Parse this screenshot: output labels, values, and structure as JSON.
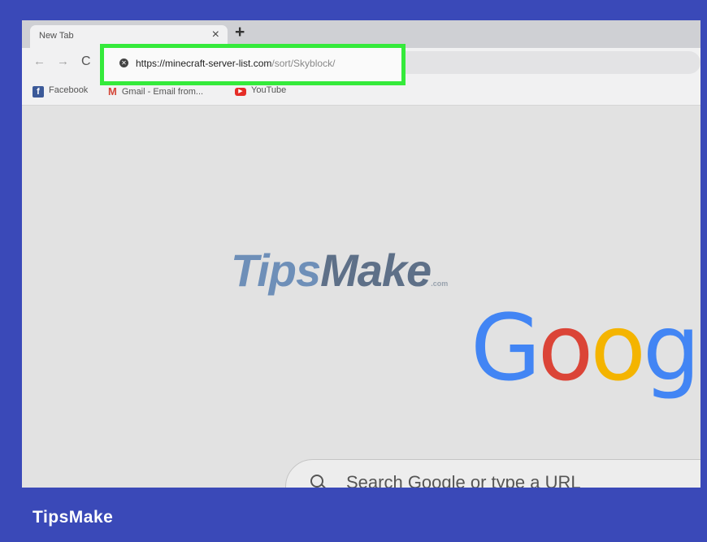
{
  "browser": {
    "tab": {
      "title": "New Tab",
      "close": "×"
    },
    "new_tab": "+",
    "nav": {
      "back": "←",
      "forward": "→",
      "reload": "C"
    },
    "url": {
      "host": "https://minecraft-server-list.com",
      "path": "/sort/Skyblock/"
    },
    "highlight_color": "#35ea3b",
    "bookmarks": [
      {
        "label": "Facebook",
        "icon": "facebook-icon"
      },
      {
        "label": "Gmail - Email from...",
        "icon": "gmail-icon"
      },
      {
        "label": "YouTube",
        "icon": "youtube-icon"
      }
    ]
  },
  "page": {
    "logo_letters": [
      "G",
      "o",
      "o",
      "g"
    ],
    "logo_colors": [
      "#4285f4",
      "#db4437",
      "#f4b400",
      "#4285f4"
    ],
    "search_placeholder": "Search Google or type a URL"
  },
  "watermark": {
    "tips": "Tips",
    "make": "Make",
    "com": ".com"
  },
  "footer": {
    "brand": "TipsMake"
  },
  "colors": {
    "background": "#3a49b8"
  }
}
